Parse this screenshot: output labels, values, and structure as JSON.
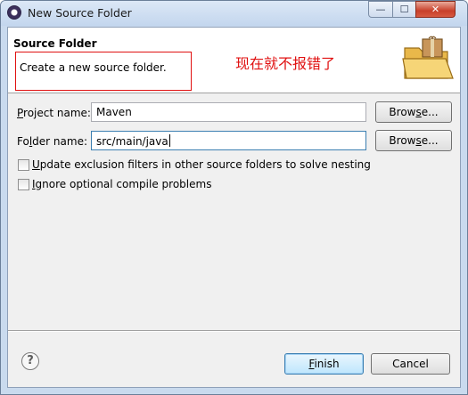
{
  "window": {
    "title": "New Source Folder",
    "min_glyph": "—",
    "max_glyph": "☐",
    "close_glyph": "✕"
  },
  "banner": {
    "title": "Source Folder",
    "description": "Create a new source folder.",
    "annotation": "现在就不报错了",
    "annotation_color": "#e01010"
  },
  "form": {
    "project": {
      "label_pre": "",
      "label_accel": "P",
      "label_post": "roject name:",
      "value": "Maven",
      "browse_pre": "Brow",
      "browse_accel": "s",
      "browse_post": "e..."
    },
    "folder": {
      "label_pre": "Fo",
      "label_accel": "l",
      "label_post": "der name:",
      "value": "src/main/java",
      "browse_pre": "Brow",
      "browse_accel": "s",
      "browse_post": "e..."
    },
    "options": [
      {
        "accel": "U",
        "rest": "pdate exclusion filters in other source folders to solve nesting",
        "checked": false
      },
      {
        "accel": "I",
        "rest": "gnore optional compile problems",
        "checked": false
      }
    ]
  },
  "footer": {
    "help_glyph": "?",
    "finish_accel": "F",
    "finish_rest": "inish",
    "cancel_label": "Cancel"
  }
}
